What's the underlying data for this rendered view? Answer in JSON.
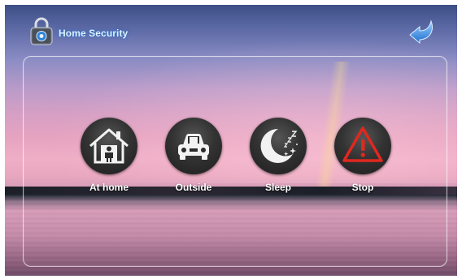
{
  "header": {
    "title": "Home Security",
    "app_icon": "padlock-icon",
    "back_icon": "back-arrow-icon"
  },
  "modes": [
    {
      "label": "At home",
      "icon": "house-person-icon"
    },
    {
      "label": "Outside",
      "icon": "car-icon"
    },
    {
      "label": "Sleep",
      "icon": "moon-stars-icon"
    },
    {
      "label": "Stop",
      "icon": "warning-triangle-icon",
      "icon_color": "#e0281f"
    }
  ],
  "colors": {
    "title_glow": "#2878dc",
    "button_fill": "#2a2a2a",
    "stop_accent": "#e0281f"
  }
}
